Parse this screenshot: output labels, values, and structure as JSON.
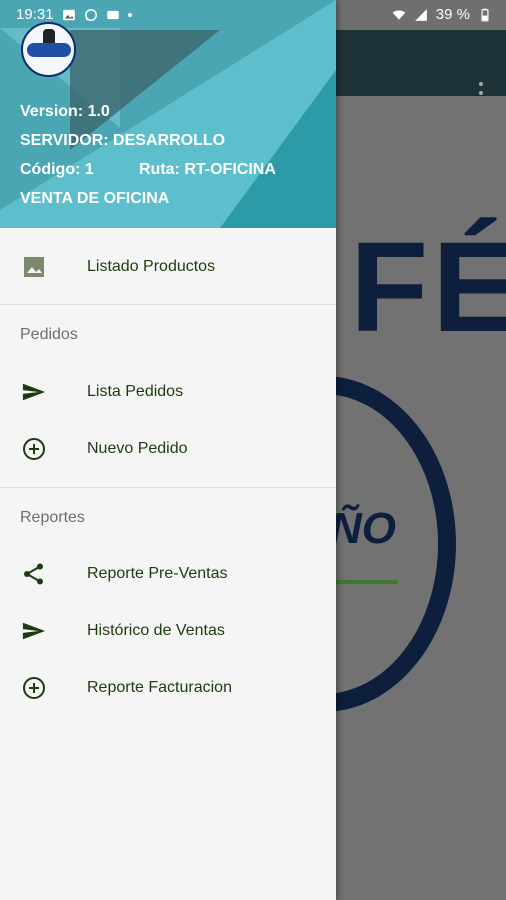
{
  "status_bar": {
    "time": "19:31",
    "battery_percent": "39 %",
    "left_icons": [
      "image-icon",
      "whatsapp-icon",
      "app-notification-icon"
    ],
    "right_icons": [
      "wifi-icon",
      "signal-icon",
      "battery-icon"
    ]
  },
  "drawer": {
    "header": {
      "version": "Version: 1.0",
      "server": "SERVIDOR: DESARROLLO",
      "code": "Código: 1",
      "route": "Ruta: RT-OFICINA",
      "sale_type": "VENTA DE OFICINA"
    },
    "top_items": [
      {
        "label": "Listado Productos",
        "icon": "image-icon"
      }
    ],
    "sections": [
      {
        "title": "Pedidos",
        "items": [
          {
            "label": "Lista Pedidos",
            "icon": "send-icon"
          },
          {
            "label": "Nuevo Pedido",
            "icon": "add-circle-icon"
          }
        ]
      },
      {
        "title": "Reportes",
        "items": [
          {
            "label": "Reporte Pre-Ventas",
            "icon": "share-icon"
          },
          {
            "label": "Histórico de Ventas",
            "icon": "send-icon"
          },
          {
            "label": "Reporte Facturacion",
            "icon": "add-circle-icon"
          }
        ]
      }
    ]
  },
  "background": {
    "big_text": "FÉ",
    "word": "ÑO"
  },
  "colors": {
    "icon_green": "#1d3b10",
    "appbar": "#1e3338",
    "header_teal": "#5dbfcb",
    "logo_navy": "#0d1f3c"
  }
}
